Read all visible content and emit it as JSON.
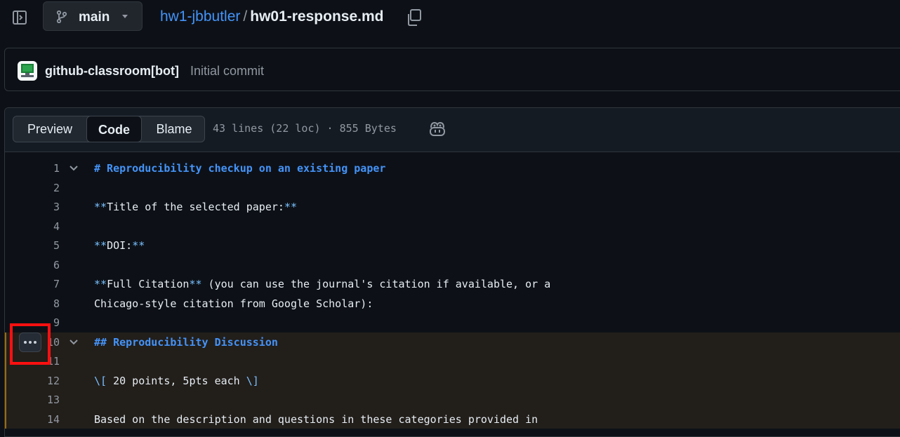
{
  "header": {
    "branch": "main",
    "repo": "hw1-jbbutler",
    "separator": "/",
    "file": "hw01-response.md"
  },
  "commit": {
    "author": "github-classroom[bot]",
    "message": "Initial commit"
  },
  "file_view": {
    "tabs": {
      "preview": "Preview",
      "code": "Code",
      "blame": "Blame"
    },
    "active_tab": "Code",
    "meta": "43 lines (22 loc) · 855 Bytes"
  },
  "code_lines": [
    {
      "num": "1",
      "text": "# Reproducibility checkup on an existing paper"
    },
    {
      "num": "2",
      "text": ""
    },
    {
      "num": "3",
      "text": "**Title of the selected paper:**"
    },
    {
      "num": "4",
      "text": ""
    },
    {
      "num": "5",
      "text": "**DOI:**"
    },
    {
      "num": "6",
      "text": ""
    },
    {
      "num": "7",
      "text": "**Full Citation** (you can use the journal's citation if available, or a"
    },
    {
      "num": "8",
      "text": "Chicago-style citation from Google Scholar):"
    },
    {
      "num": "9",
      "text": ""
    },
    {
      "num": "10",
      "text": "## Reproducibility Discussion"
    },
    {
      "num": "11",
      "text": ""
    },
    {
      "num": "12",
      "text": "\\[ 20 points, 5pts each \\]"
    },
    {
      "num": "13",
      "text": ""
    },
    {
      "num": "14",
      "text": "Based on the description and questions in these categories provided in"
    }
  ],
  "colors": {
    "accent": "#4493f8",
    "highlight_bar": "#9e6a03",
    "annotation_box": "#ff1010"
  },
  "icons": {
    "sidebar": "sidebar-expand-icon",
    "branch": "git-branch-icon",
    "caret": "triangle-down-icon",
    "copy": "copy-icon",
    "copilot": "copilot-icon",
    "more": "kebab-horizontal-icon",
    "fold": "chevron-down-icon"
  }
}
